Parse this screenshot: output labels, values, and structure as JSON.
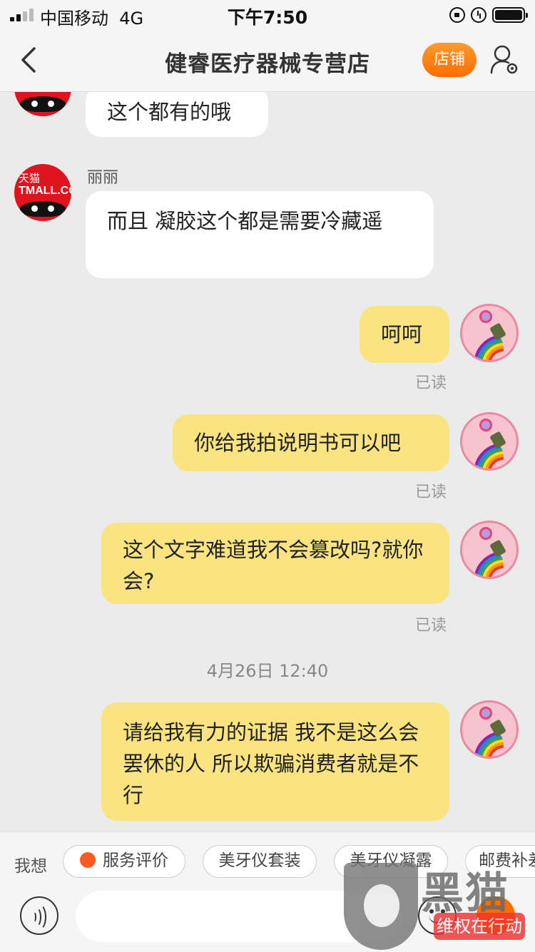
{
  "status_bar": {
    "carrier": "中国移动",
    "network": "4G",
    "time": "下午7:50"
  },
  "nav": {
    "title": "健睿医疗器械专营店",
    "shop_label": "店铺",
    "icons": {
      "back": "chevron-left-icon",
      "user": "user-settings-icon"
    }
  },
  "chat": {
    "messages": [
      {
        "side": "left",
        "text": "这个都有的哦"
      },
      {
        "side": "left",
        "sender": "丽丽",
        "text": "而且 凝胶这个都是需要冷藏遥"
      },
      {
        "side": "right",
        "text": "呵呵",
        "status": "已读"
      },
      {
        "side": "right",
        "text": "你给我拍说明书可以吧",
        "status": "已读"
      },
      {
        "side": "right",
        "text": "这个文字难道我不会篡改吗?就你会?",
        "status": "已读"
      },
      {
        "side": "right",
        "text": "请给我有力的证据 我不是这么会罢休的人 所以欺骗消费者就是不行"
      }
    ],
    "timestamp": "4月26日 12:40",
    "avatar_left": {
      "line1": "天猫",
      "line2": "TMALL.COM"
    }
  },
  "quick_replies": {
    "label": "我想",
    "items": [
      "服务评价",
      "美牙仪套装",
      "美牙仪凝露",
      "邮费补差"
    ]
  },
  "input": {
    "icons": {
      "voice": "voice-icon",
      "emoji": "emoji-icon",
      "plus": "plus-icon"
    }
  },
  "watermark": {
    "logo": "黑猫",
    "tag": "维权在行动"
  },
  "colors": {
    "accent": "#ff6d00",
    "bubble_mine": "#f9e481",
    "bubble_other": "#ffffff"
  }
}
